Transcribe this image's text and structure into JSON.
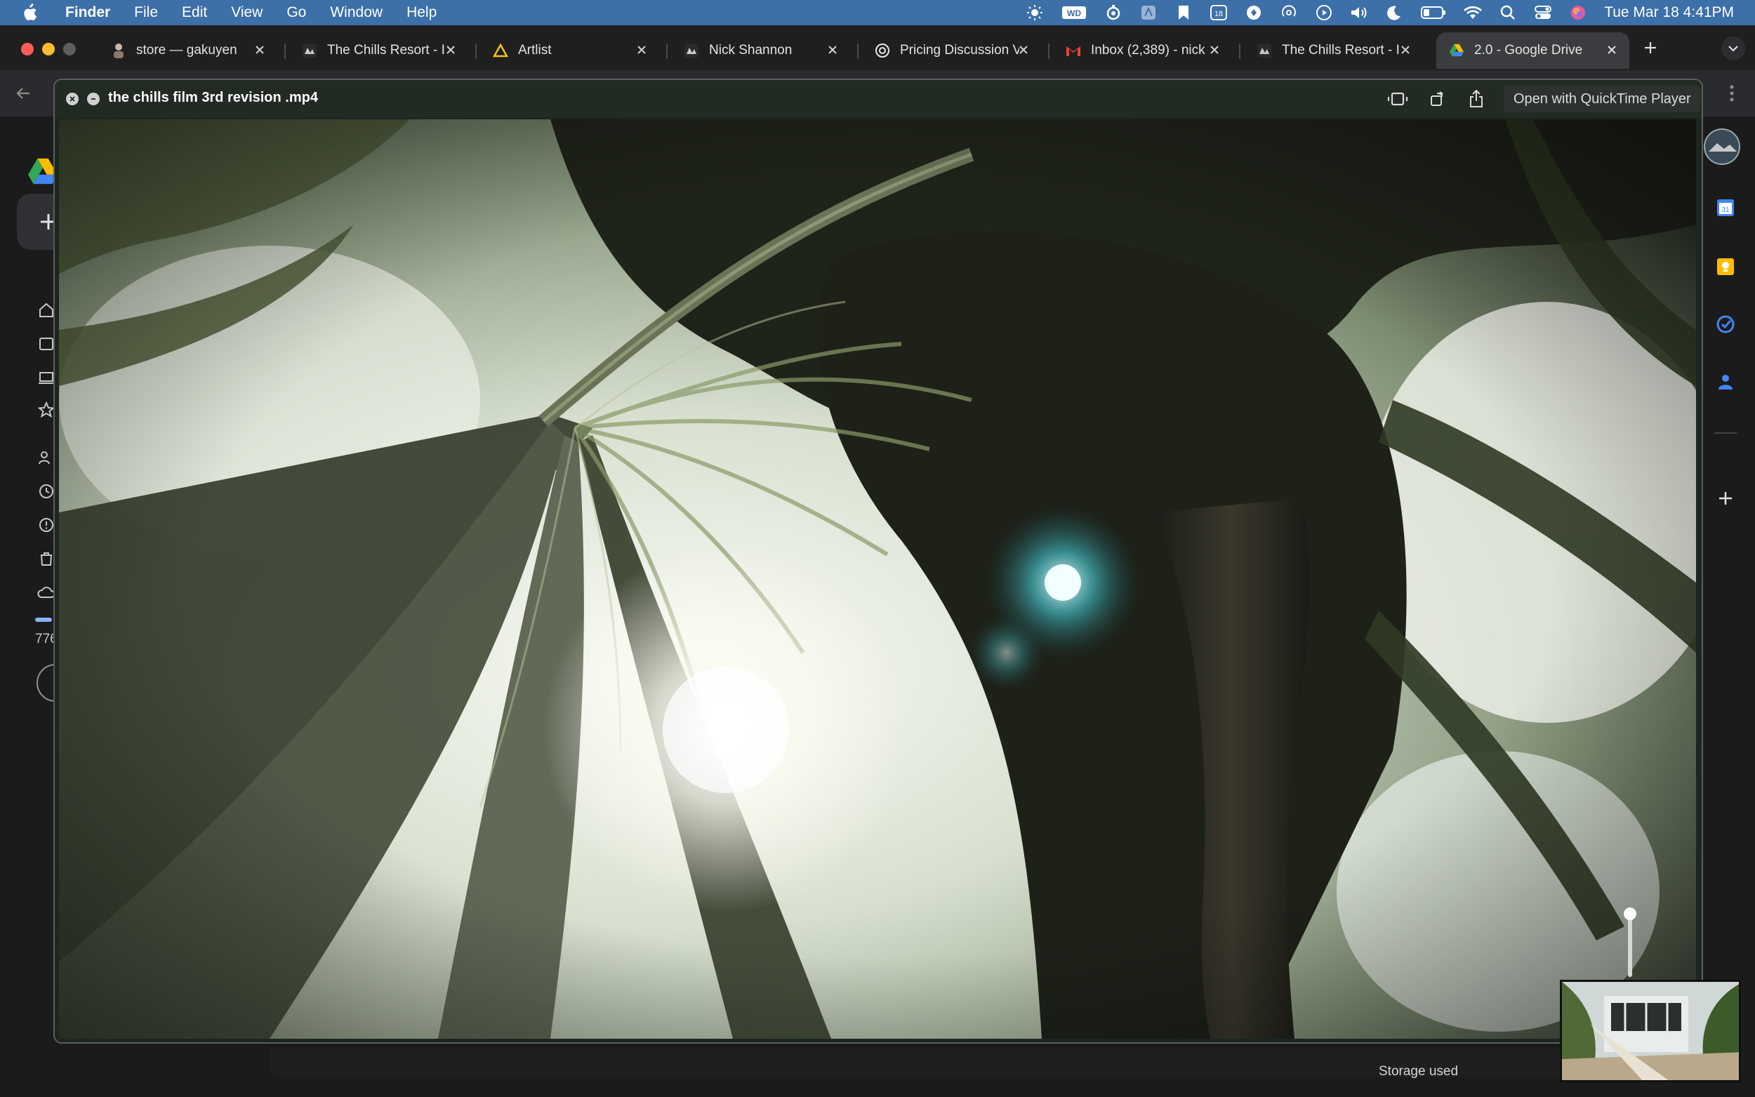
{
  "menubar": {
    "app_name": "Finder",
    "items": [
      "File",
      "Edit",
      "View",
      "Go",
      "Window",
      "Help"
    ],
    "status_icons": [
      "brightness-icon",
      "wd-drive-icon",
      "timer-icon",
      "app-icon",
      "bookmark-icon",
      "calendar-icon",
      "record-icon",
      "airdrop-icon",
      "play-icon",
      "volume-icon",
      "moon-icon",
      "battery-icon",
      "wifi-icon",
      "spotlight-icon",
      "control-center-icon",
      "siri-icon"
    ],
    "calendar_day": "18",
    "clock": "Tue Mar 18  4:41PM"
  },
  "browser": {
    "tabs": [
      {
        "title": "store — gakuyen",
        "favicon": "person-icon",
        "active": false
      },
      {
        "title": "The Chills Resort - I",
        "favicon": "chills-icon",
        "active": false
      },
      {
        "title": "Artlist",
        "favicon": "artlist-icon",
        "active": false
      },
      {
        "title": "Nick Shannon",
        "favicon": "chills-icon",
        "active": false
      },
      {
        "title": "Pricing Discussion V",
        "favicon": "chatgpt-icon",
        "active": false
      },
      {
        "title": "Inbox (2,389) - nick",
        "favicon": "gmail-icon",
        "active": false
      },
      {
        "title": "The Chills Resort - I",
        "favicon": "chills-icon",
        "active": false
      },
      {
        "title": "2.0 - Google Drive",
        "favicon": "google-drive-icon",
        "active": true
      }
    ]
  },
  "drive": {
    "storage_number": "776",
    "storage_label": "Storage used"
  },
  "quicklook": {
    "file_name": "the chills film 3rd revision .mp4",
    "open_with": "Open with QuickTime Player",
    "volume": 1.0
  },
  "colors": {
    "menubar": "#3d6fa8",
    "tab_active": "#3a3c3f",
    "drive_accent": "#8ab4f8",
    "quicklook_bg": "#1c2620"
  }
}
